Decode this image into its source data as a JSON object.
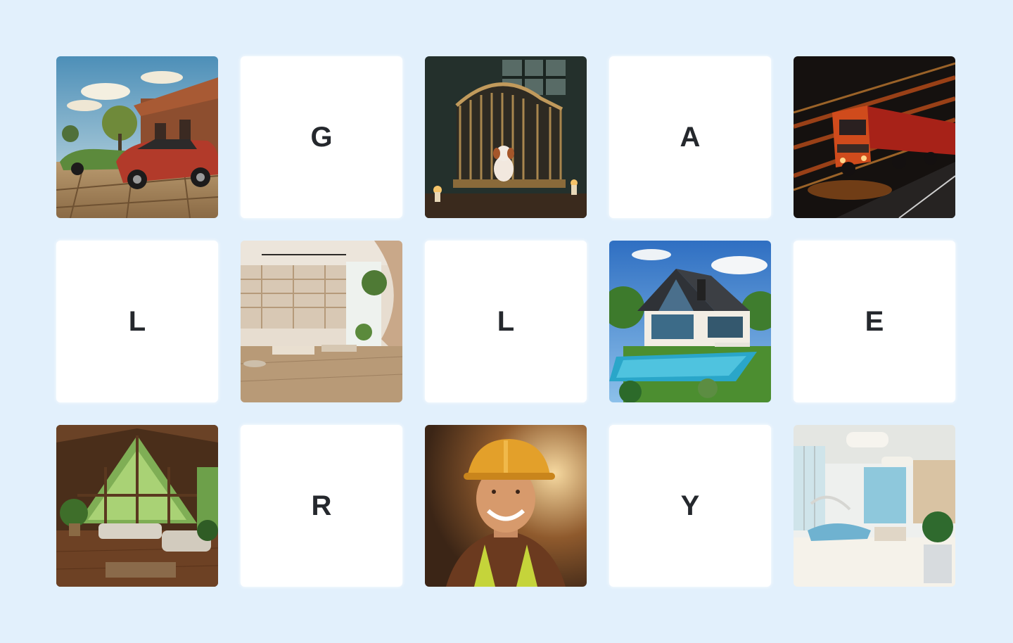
{
  "gallery": {
    "tiles": [
      {
        "kind": "photo",
        "subject": "vintage-cars-street"
      },
      {
        "kind": "letter",
        "text": "G"
      },
      {
        "kind": "photo",
        "subject": "dog-in-cage"
      },
      {
        "kind": "letter",
        "text": "A"
      },
      {
        "kind": "photo",
        "subject": "speeding-truck"
      },
      {
        "kind": "letter",
        "text": "L"
      },
      {
        "kind": "photo",
        "subject": "retail-store-interior"
      },
      {
        "kind": "letter",
        "text": "L"
      },
      {
        "kind": "photo",
        "subject": "modern-house-pool"
      },
      {
        "kind": "letter",
        "text": "E"
      },
      {
        "kind": "photo",
        "subject": "cabin-living-room"
      },
      {
        "kind": "letter",
        "text": "R"
      },
      {
        "kind": "photo",
        "subject": "smiling-construction-worker"
      },
      {
        "kind": "letter",
        "text": "Y"
      },
      {
        "kind": "photo",
        "subject": "dental-clinic-interior"
      }
    ]
  },
  "colors": {
    "background": "#e2f0fc",
    "tile": "#ffffff",
    "letter": "#25282d"
  }
}
